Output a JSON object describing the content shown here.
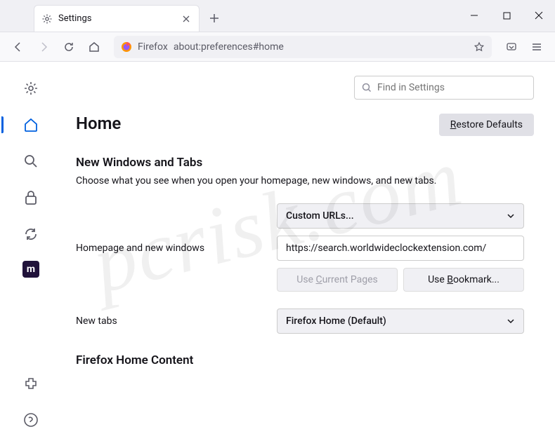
{
  "tab": {
    "title": "Settings"
  },
  "urlbar": {
    "identity": "Firefox",
    "url": "about:preferences#home"
  },
  "search": {
    "placeholder": "Find in Settings"
  },
  "page": {
    "title": "Home"
  },
  "buttons": {
    "restore": "Restore Defaults",
    "restore_key": "R",
    "use_current": "Use Current Pages",
    "use_current_key": "C",
    "use_bookmark": "Use Bookmark...",
    "use_bookmark_key": "B"
  },
  "section1": {
    "title": "New Windows and Tabs",
    "desc": "Choose what you see when you open your homepage, new windows, and new tabs."
  },
  "form": {
    "homepage_label": "Homepage and new windows",
    "homepage_select": "Custom URLs...",
    "homepage_url": "https://search.worldwideclockextension.com/",
    "newtabs_label": "New tabs",
    "newtabs_select": "Firefox Home (Default)"
  },
  "section2": {
    "title": "Firefox Home Content"
  },
  "watermark": "pcrisk.com"
}
